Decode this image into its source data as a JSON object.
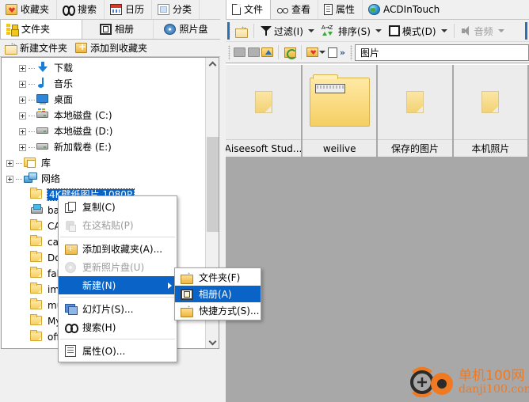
{
  "window": {
    "theme_accent": "#0a64c8",
    "content_bg": "#a8a8a8"
  },
  "left_pane": {
    "tabs_top": [
      {
        "label": "收藏夹",
        "icon": "favorites-icon",
        "active": false
      },
      {
        "label": "搜索",
        "icon": "binoculars-icon",
        "active": false
      },
      {
        "label": "日历",
        "icon": "calendar-icon",
        "active": false
      },
      {
        "label": "分类",
        "icon": "categories-icon",
        "active": false
      }
    ],
    "tabs_second": [
      {
        "label": "文件夹",
        "icon": "folder-tree-icon",
        "active": true
      },
      {
        "label": "相册",
        "icon": "album-icon",
        "active": false
      },
      {
        "label": "照片盘",
        "icon": "photo-disc-icon",
        "active": false
      }
    ],
    "toolbar": [
      {
        "label": "新建文件夹",
        "icon": "new-folder-icon"
      },
      {
        "label": "添加到收藏夹",
        "icon": "add-to-favorites-icon"
      }
    ],
    "tree": [
      {
        "label": "下载",
        "icon": "download-icon",
        "indent": 2,
        "expander": true,
        "selected": false
      },
      {
        "label": "音乐",
        "icon": "music-icon",
        "indent": 2,
        "expander": true,
        "selected": false
      },
      {
        "label": "桌面",
        "icon": "desktop-icon",
        "indent": 2,
        "expander": true,
        "selected": false
      },
      {
        "label": "本地磁盘 (C:)",
        "icon": "system-drive-icon",
        "indent": 2,
        "expander": true,
        "selected": false
      },
      {
        "label": "本地磁盘 (D:)",
        "icon": "drive-icon",
        "indent": 2,
        "expander": true,
        "selected": false
      },
      {
        "label": "新加载卷 (E:)",
        "icon": "drive-icon",
        "indent": 2,
        "expander": true,
        "selected": false
      },
      {
        "label": "库",
        "icon": "library-icon",
        "indent": 1,
        "expander": true,
        "selected": false
      },
      {
        "label": "网络",
        "icon": "network-icon",
        "indent": 1,
        "expander": true,
        "selected": false
      },
      {
        "label": "4K壁纸图片 1080P",
        "icon": "folder-icon",
        "indent": 2,
        "expander": false,
        "selected": true
      },
      {
        "label": "backup",
        "icon": "printer-icon",
        "indent": 2,
        "expander": false,
        "selected": false
      },
      {
        "label": "CAD",
        "icon": "folder-icon",
        "indent": 2,
        "expander": false,
        "selected": false
      },
      {
        "label": "careui",
        "icon": "folder-icon",
        "indent": 2,
        "expander": false,
        "selected": false
      },
      {
        "label": "Downloads",
        "icon": "folder-icon",
        "indent": 2,
        "expander": false,
        "selected": false
      },
      {
        "label": "fab",
        "icon": "folder-icon",
        "indent": 2,
        "expander": false,
        "selected": false
      },
      {
        "label": "images",
        "icon": "folder-icon",
        "indent": 2,
        "expander": false,
        "selected": false
      },
      {
        "label": "music",
        "icon": "folder-icon",
        "indent": 2,
        "expander": false,
        "selected": false
      },
      {
        "label": "MyEclipse",
        "icon": "folder-icon",
        "indent": 2,
        "expander": false,
        "selected": false
      },
      {
        "label": "office",
        "icon": "folder-icon",
        "indent": 2,
        "expander": false,
        "selected": false
      }
    ],
    "scrollbar": {
      "up_arrow": "▲",
      "down_arrow": "▼"
    }
  },
  "right_pane": {
    "tabs": [
      {
        "label": "文件",
        "icon": "file-icon",
        "active": true
      },
      {
        "label": "查看",
        "icon": "view-eyes-icon",
        "active": false
      },
      {
        "label": "属性",
        "icon": "properties-doc-icon",
        "active": false
      },
      {
        "label": "ACDInTouch",
        "icon": "globe-icon",
        "active": false
      }
    ],
    "toolbar_main": [
      {
        "label": "",
        "icon": "new-folder-icon",
        "dropdown": false,
        "disabled": false
      },
      {
        "label": "过滤(I)",
        "icon": "filter-icon",
        "dropdown": true,
        "disabled": false
      },
      {
        "label": "排序(S)",
        "icon": "sort-az-icon",
        "dropdown": true,
        "disabled": false
      },
      {
        "label": "模式(D)",
        "icon": "mode-icon",
        "dropdown": true,
        "disabled": false
      },
      {
        "label": "音频",
        "icon": "audio-icon",
        "dropdown": true,
        "disabled": true
      }
    ],
    "toolbar_nav": [
      {
        "icon": "back-icon",
        "disabled": true
      },
      {
        "icon": "forward-icon",
        "disabled": true
      },
      {
        "icon": "up-folder-icon",
        "disabled": false
      },
      {
        "icon": "refresh-icon",
        "disabled": false
      },
      {
        "icon": "favorites-dropdown-icon",
        "disabled": false
      },
      {
        "icon": "properties-panel-icon",
        "disabled": false
      },
      {
        "icon": "overflow-chevrons-icon",
        "disabled": false
      }
    ],
    "overflow_label": "»",
    "address": {
      "value": "图片",
      "placeholder": ""
    },
    "thumbnails": [
      {
        "caption": "Aiseesoft Stud...",
        "kind": "folder",
        "selected": false
      },
      {
        "caption": "weilive",
        "kind": "folder-preview",
        "selected": true
      },
      {
        "caption": "保存的图片",
        "kind": "folder",
        "selected": false
      },
      {
        "caption": "本机照片",
        "kind": "folder",
        "selected": false
      }
    ]
  },
  "context_menu": {
    "items": [
      {
        "label": "复制(C)",
        "icon": "copy-icon",
        "disabled": false,
        "highlight": false,
        "submenu": false,
        "separator_after": false
      },
      {
        "label": "在这粘贴(P)",
        "icon": "paste-icon",
        "disabled": true,
        "highlight": false,
        "submenu": false,
        "separator_after": true
      },
      {
        "label": "添加到收藏夹(A)...",
        "icon": "add-to-favorites-icon",
        "disabled": false,
        "highlight": false,
        "submenu": false,
        "separator_after": false
      },
      {
        "label": "更新照片盘(U)",
        "icon": "photo-disc-icon",
        "disabled": true,
        "highlight": false,
        "submenu": false,
        "separator_after": false
      },
      {
        "label": "新建(N)",
        "icon": "",
        "disabled": false,
        "highlight": true,
        "submenu": true,
        "separator_after": true
      },
      {
        "label": "幻灯片(S)...",
        "icon": "slideshow-icon",
        "disabled": false,
        "highlight": false,
        "submenu": false,
        "separator_after": false
      },
      {
        "label": "搜索(H)",
        "icon": "binoculars-icon",
        "disabled": false,
        "highlight": false,
        "submenu": false,
        "separator_after": true
      },
      {
        "label": "属性(O)...",
        "icon": "properties-doc-icon",
        "disabled": false,
        "highlight": false,
        "submenu": false,
        "separator_after": false
      }
    ],
    "submenu": {
      "items": [
        {
          "label": "文件夹(F)",
          "icon": "new-folder-icon",
          "highlight": false
        },
        {
          "label": "相册(A)",
          "icon": "new-album-icon",
          "highlight": true
        },
        {
          "label": "快捷方式(S)...",
          "icon": "new-shortcut-icon",
          "highlight": false
        }
      ]
    }
  },
  "watermark": {
    "cn": "单机100网",
    "en": "danji100.com",
    "color": "#f07a22"
  }
}
